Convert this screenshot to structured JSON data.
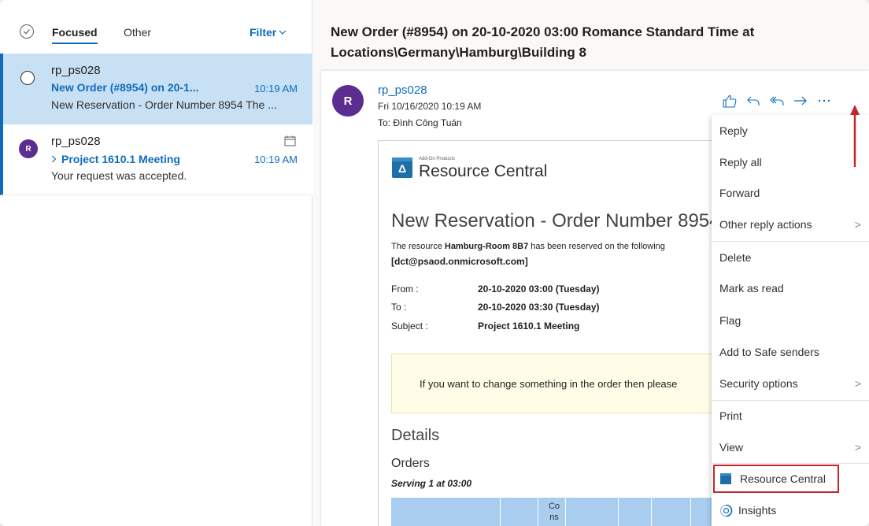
{
  "tabs": {
    "focused": "Focused",
    "other": "Other",
    "filter": "Filter"
  },
  "messages": [
    {
      "sender": "rp_ps028",
      "subject": "New Order (#8954) on 20-1...",
      "time": "10:19 AM",
      "preview": "New Reservation - Order Number 8954 The ..."
    },
    {
      "avatar": "R",
      "sender": "rp_ps028",
      "subject": "Project 1610.1 Meeting",
      "time": "10:19 AM",
      "preview": "Your request was accepted."
    }
  ],
  "reading": {
    "subject": "New Order (#8954) on 20-10-2020 03:00 Romance Standard Time at Locations\\Germany\\Hamburg\\Building 8",
    "avatar": "R",
    "sender": "rp_ps028",
    "date": "Fri 10/16/2020 10:19 AM",
    "to": "To: Đình Công Tuán"
  },
  "email_body": {
    "logo_small": "Add-On Products",
    "logo_name": "Resource Central",
    "title": "New Reservation - Order Number 8954",
    "intro_prefix": "The resource ",
    "intro_bold": "Hamburg-Room 8B7",
    "intro_suffix": " has been reserved on the following",
    "email": "[dct@psaod.onmicrosoft.com]",
    "rows": [
      {
        "label": "From :",
        "value": "20-10-2020 03:00 (Tuesday)"
      },
      {
        "label": "To :",
        "value": "20-10-2020 03:30 (Tuesday)"
      },
      {
        "label": "Subject :",
        "value": "Project 1610.1 Meeting"
      }
    ],
    "note": "If you want to change something in the order then please",
    "details": "Details",
    "orders": "Orders",
    "serving": "Serving 1 at 03:00",
    "table_header": "Co ns"
  },
  "menu": {
    "items": [
      "Reply",
      "Reply all",
      "Forward",
      "Other reply actions",
      "Delete",
      "Mark as read",
      "Flag",
      "Add to Safe senders",
      "Security options",
      "Print",
      "View",
      "Resource Central",
      "Insights"
    ]
  },
  "colors": {
    "accent": "#0f6cbd",
    "selected": "#c7e0f4",
    "avatar": "#5c2d91",
    "highlight": "#c4262e"
  }
}
